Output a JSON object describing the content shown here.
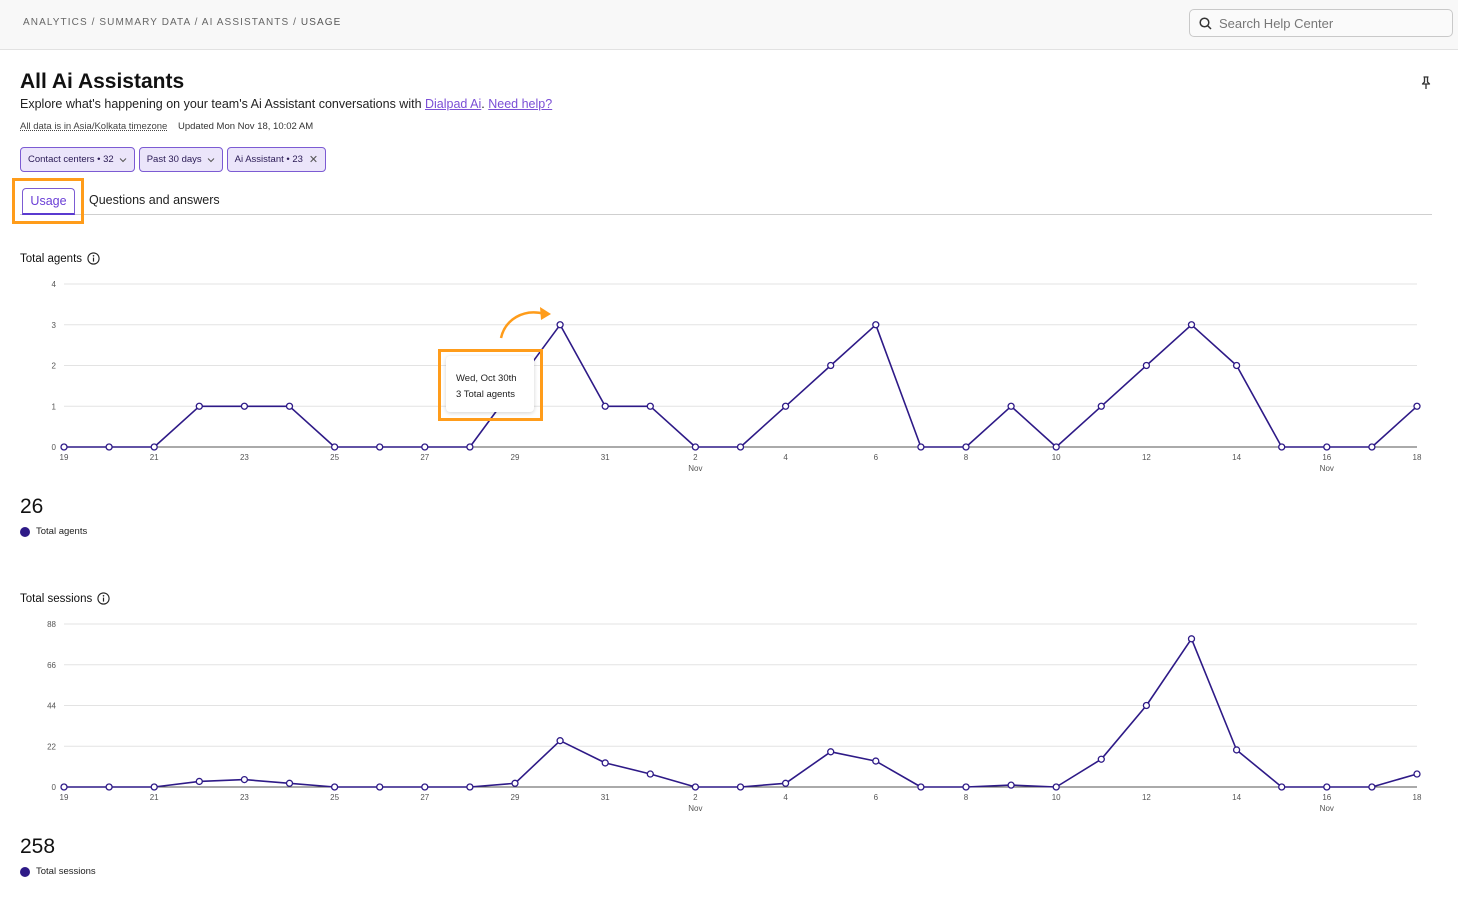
{
  "breadcrumb": {
    "path": "ANALYTICS / SUMMARY DATA / AI ASSISTANTS / ",
    "current": "USAGE"
  },
  "search": {
    "placeholder": "Search Help Center"
  },
  "header": {
    "title": "All Ai Assistants",
    "subtitle_prefix": "Explore what's happening on your team's Ai Assistant conversations with ",
    "subtitle_link": "Dialpad Ai",
    "subtitle_sep": ". ",
    "help_link": "Need help?",
    "timezone": "All data is in Asia/Kolkata timezone",
    "updated": "Updated Mon Nov 18, 10:02 AM"
  },
  "filters": [
    {
      "label": "Contact centers • 32"
    },
    {
      "label": "Past 30 days"
    },
    {
      "label": "Ai Assistant • 23"
    }
  ],
  "tabs": [
    {
      "label": "Usage",
      "active": true
    },
    {
      "label": "Questions and answers",
      "active": false
    }
  ],
  "colors": {
    "accent": "#7c5bd3",
    "series": "#2e1a87",
    "highlight": "#ff9c1a"
  },
  "tooltip": {
    "line1": "Wed, Oct 30th",
    "line2": "3 Total agents"
  },
  "chart_data": [
    {
      "type": "line",
      "title": "Total agents",
      "x": [
        "Oct 19",
        "Oct 20",
        "Oct 21",
        "Oct 22",
        "Oct 23",
        "Oct 24",
        "Oct 25",
        "Oct 26",
        "Oct 27",
        "Oct 28",
        "Oct 29",
        "Oct 30",
        "Oct 31",
        "Nov 1",
        "Nov 2",
        "Nov 3",
        "Nov 4",
        "Nov 5",
        "Nov 6",
        "Nov 7",
        "Nov 8",
        "Nov 9",
        "Nov 10",
        "Nov 11",
        "Nov 12",
        "Nov 13",
        "Nov 14",
        "Nov 15",
        "Nov 16",
        "Nov 17",
        "Nov 18"
      ],
      "tick_labels": [
        "19",
        "21",
        "23",
        "25",
        "27",
        "29",
        "31",
        "2",
        "4",
        "6",
        "8",
        "10",
        "12",
        "14",
        "16",
        "18"
      ],
      "month_labels": [
        {
          "at": "2",
          "label": "Nov"
        },
        {
          "at": "16",
          "label": "Nov"
        }
      ],
      "yticks": [
        0,
        1,
        2,
        3,
        4
      ],
      "ylim": [
        0,
        4
      ],
      "grid": true,
      "series": [
        {
          "name": "Total agents",
          "values": [
            0,
            0,
            0,
            1,
            1,
            1,
            0,
            0,
            0,
            0,
            1.5,
            3,
            1,
            1,
            0,
            0,
            1,
            2,
            3,
            0,
            0,
            1,
            0,
            1,
            2,
            3,
            2,
            0,
            0,
            0,
            1
          ]
        }
      ],
      "total": "26"
    },
    {
      "type": "line",
      "title": "Total sessions",
      "x": [
        "Oct 19",
        "Oct 20",
        "Oct 21",
        "Oct 22",
        "Oct 23",
        "Oct 24",
        "Oct 25",
        "Oct 26",
        "Oct 27",
        "Oct 28",
        "Oct 29",
        "Oct 30",
        "Oct 31",
        "Nov 1",
        "Nov 2",
        "Nov 3",
        "Nov 4",
        "Nov 5",
        "Nov 6",
        "Nov 7",
        "Nov 8",
        "Nov 9",
        "Nov 10",
        "Nov 11",
        "Nov 12",
        "Nov 13",
        "Nov 14",
        "Nov 15",
        "Nov 16",
        "Nov 17",
        "Nov 18"
      ],
      "tick_labels": [
        "19",
        "21",
        "23",
        "25",
        "27",
        "29",
        "31",
        "2",
        "4",
        "6",
        "8",
        "10",
        "12",
        "14",
        "16",
        "18"
      ],
      "month_labels": [
        {
          "at": "2",
          "label": "Nov"
        },
        {
          "at": "16",
          "label": "Nov"
        }
      ],
      "yticks": [
        0,
        22,
        44,
        66,
        88
      ],
      "ylim": [
        0,
        88
      ],
      "grid": true,
      "series": [
        {
          "name": "Total sessions",
          "values": [
            0,
            0,
            0,
            3,
            4,
            2,
            0,
            0,
            0,
            0,
            2,
            25,
            13,
            7,
            0,
            0,
            2,
            19,
            14,
            0,
            0,
            1,
            0,
            15,
            44,
            80,
            20,
            0,
            0,
            0,
            7
          ]
        }
      ],
      "total": "258"
    }
  ]
}
